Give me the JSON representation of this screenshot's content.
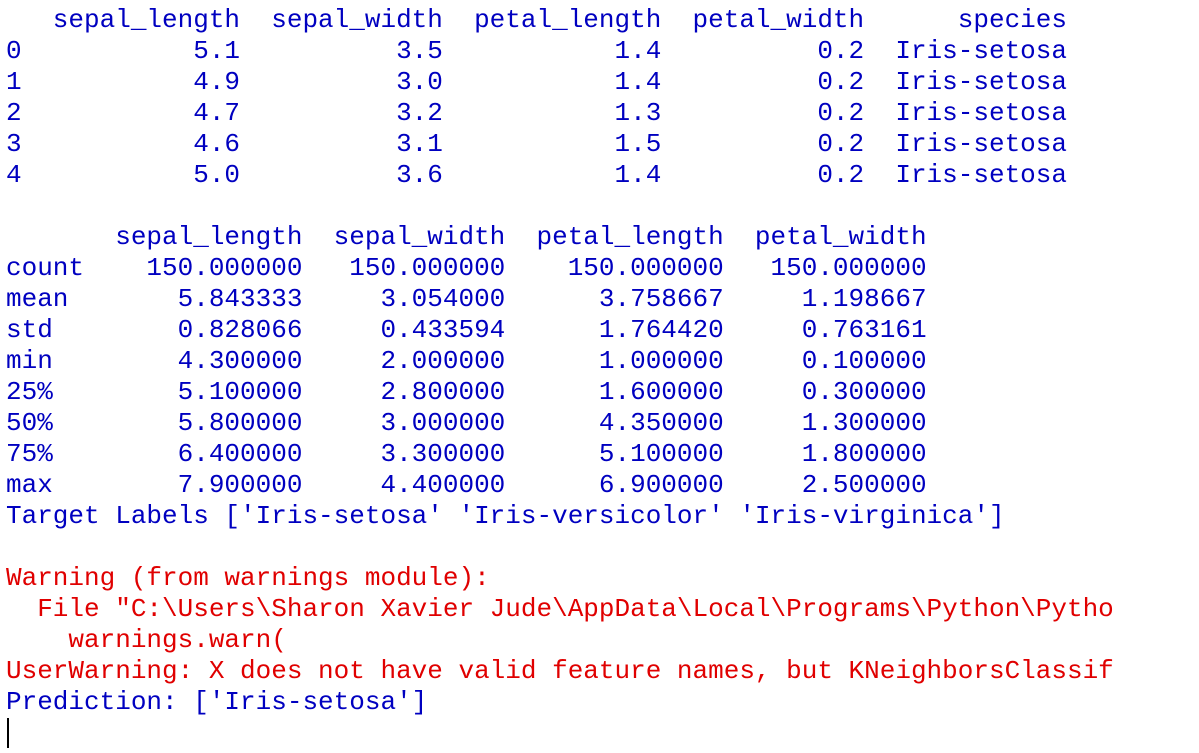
{
  "console": {
    "lines": [
      {
        "text": "   sepal_length  sepal_width  petal_length  petal_width      species",
        "kind": "stdout"
      },
      {
        "text": "0           5.1          3.5           1.4          0.2  Iris-setosa",
        "kind": "stdout"
      },
      {
        "text": "1           4.9          3.0           1.4          0.2  Iris-setosa",
        "kind": "stdout"
      },
      {
        "text": "2           4.7          3.2           1.3          0.2  Iris-setosa",
        "kind": "stdout"
      },
      {
        "text": "3           4.6          3.1           1.5          0.2  Iris-setosa",
        "kind": "stdout"
      },
      {
        "text": "4           5.0          3.6           1.4          0.2  Iris-setosa",
        "kind": "stdout"
      },
      {
        "text": "",
        "kind": "stdout"
      },
      {
        "text": "       sepal_length  sepal_width  petal_length  petal_width",
        "kind": "stdout"
      },
      {
        "text": "count    150.000000   150.000000    150.000000   150.000000",
        "kind": "stdout"
      },
      {
        "text": "mean       5.843333     3.054000      3.758667     1.198667",
        "kind": "stdout"
      },
      {
        "text": "std        0.828066     0.433594      1.764420     0.763161",
        "kind": "stdout"
      },
      {
        "text": "min        4.300000     2.000000      1.000000     0.100000",
        "kind": "stdout"
      },
      {
        "text": "25%        5.100000     2.800000      1.600000     0.300000",
        "kind": "stdout"
      },
      {
        "text": "50%        5.800000     3.000000      4.350000     1.300000",
        "kind": "stdout"
      },
      {
        "text": "75%        6.400000     3.300000      5.100000     1.800000",
        "kind": "stdout"
      },
      {
        "text": "max        7.900000     4.400000      6.900000     2.500000",
        "kind": "stdout"
      },
      {
        "text": "Target Labels ['Iris-setosa' 'Iris-versicolor' 'Iris-virginica']",
        "kind": "stdout"
      },
      {
        "text": "",
        "kind": "stdout"
      },
      {
        "text": "Warning (from warnings module):",
        "kind": "stderr"
      },
      {
        "text": "  File \"C:\\Users\\Sharon Xavier Jude\\AppData\\Local\\Programs\\Python\\Pytho",
        "kind": "stderr"
      },
      {
        "text": "    warnings.warn(",
        "kind": "stderr"
      },
      {
        "text": "UserWarning: X does not have valid feature names, but KNeighborsClassif",
        "kind": "stderr"
      },
      {
        "text": "Prediction: ['Iris-setosa']",
        "kind": "stdout"
      }
    ],
    "colors": {
      "stdout": "#0000c0",
      "stderr": "#e00000",
      "background": "#ffffff",
      "cursor": "#000000"
    }
  }
}
